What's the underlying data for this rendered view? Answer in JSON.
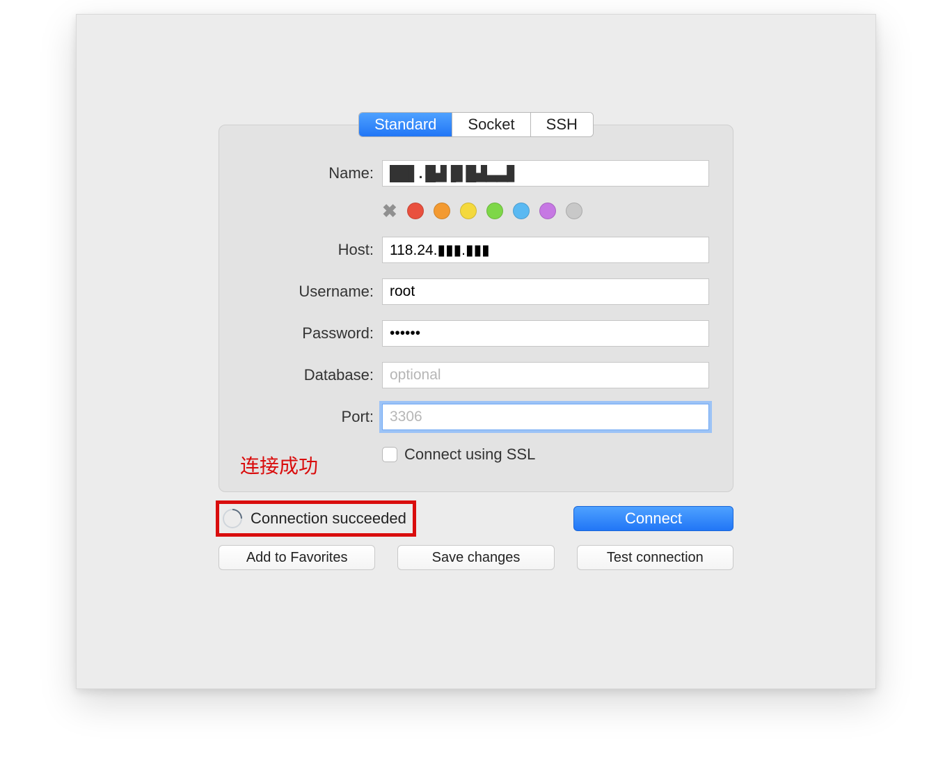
{
  "tabs": {
    "standard": "Standard",
    "socket": "Socket",
    "ssh": "SSH"
  },
  "labels": {
    "name": "Name:",
    "host": "Host:",
    "username": "Username:",
    "password": "Password:",
    "database": "Database:",
    "port": "Port:"
  },
  "fields": {
    "name_obscured": "██▌. █▟▐▋█▟▃▃▋",
    "host": "118.24.▮▮▮.▮▮▮",
    "username": "root",
    "password": "••••••",
    "database_value": "",
    "database_placeholder": "optional",
    "port_value": "",
    "port_placeholder": "3306"
  },
  "colors": {
    "clear": "✖",
    "swatches": [
      "#e9503e",
      "#f39a31",
      "#f4d93d",
      "#7ed748",
      "#5ab9f2",
      "#c678e3",
      "#c8c8c8"
    ]
  },
  "ssl": {
    "label": "Connect using SSL"
  },
  "annotation": "连接成功",
  "status": {
    "text": "Connection succeeded"
  },
  "buttons": {
    "connect": "Connect",
    "add_favorites": "Add to Favorites",
    "save_changes": "Save changes",
    "test_connection": "Test connection"
  }
}
